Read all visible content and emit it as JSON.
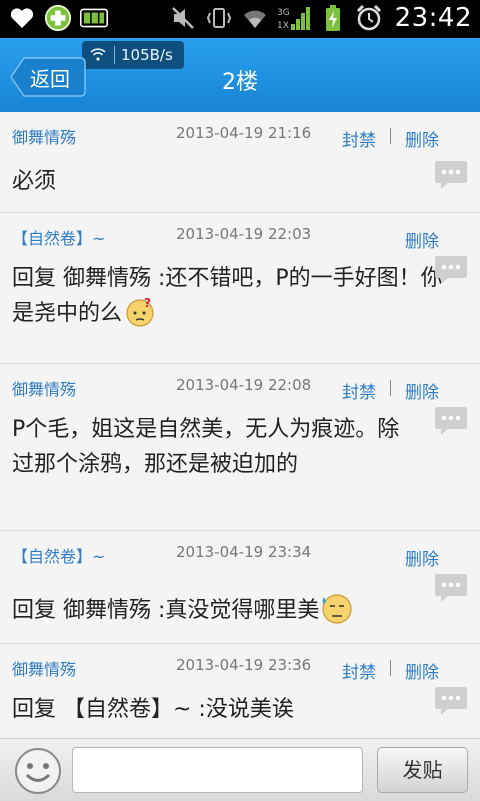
{
  "status_bar": {
    "time": "23:42",
    "left_icons": [
      "heart-icon",
      "app-plus-icon",
      "keyboard-icon"
    ],
    "right_icons": [
      "mute-icon",
      "vibrate-icon",
      "wifi-icon",
      "signal-3g-icon",
      "battery-charging-icon",
      "alarm-icon"
    ],
    "network_type": "3G",
    "network_sub": "1X"
  },
  "header": {
    "back_label": "返回",
    "title": "2楼",
    "net_speed": "105B/s"
  },
  "posts": [
    {
      "author": "御舞情殇",
      "time": "2013-04-19 21:16",
      "ban": "封禁",
      "delete": "删除",
      "text": "必须"
    },
    {
      "author": "【自然卷】~",
      "time": "2013-04-19 22:03",
      "ban": "",
      "delete": "删除",
      "text": "回复 御舞情殇 :还不错吧，P的一手好图！你是尧中的么"
    },
    {
      "author": "御舞情殇",
      "time": "2013-04-19 22:08",
      "ban": "封禁",
      "delete": "删除",
      "text": "P个毛，姐这是自然美，无人为痕迹。除过那个涂鸦，那还是被迫加的"
    },
    {
      "author": "【自然卷】~",
      "time": "2013-04-19 23:34",
      "ban": "",
      "delete": "删除",
      "text": "回复 御舞情殇 :真没觉得哪里美"
    },
    {
      "author": "御舞情殇",
      "time": "2013-04-19 23:36",
      "ban": "封禁",
      "delete": "删除",
      "text": "回复 【自然卷】~ :没说美诶"
    }
  ],
  "composer": {
    "input_value": "",
    "send_label": "发贴"
  },
  "colors": {
    "header_blue": "#1e8fe0",
    "link_blue": "#2f7dc6"
  }
}
